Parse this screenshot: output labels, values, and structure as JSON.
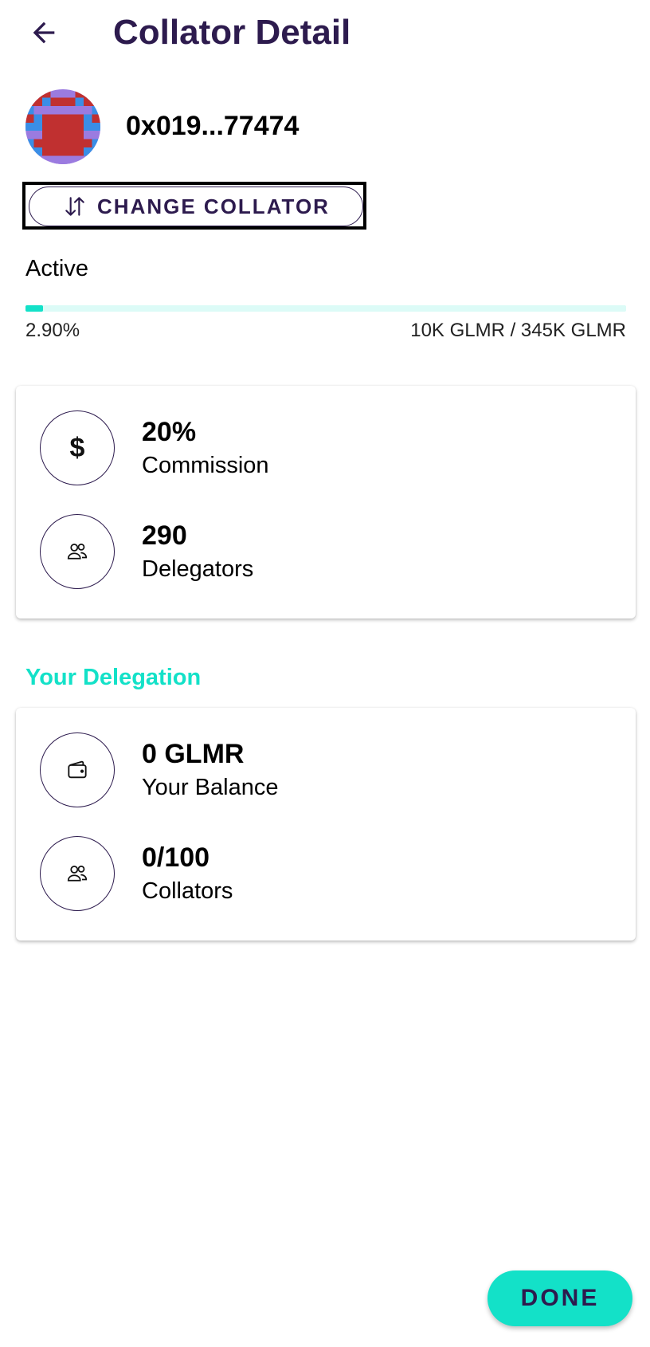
{
  "header": {
    "title": "Collator Detail",
    "back_icon": "arrow-left-icon"
  },
  "collator": {
    "address": "0x019...77474",
    "avatar_colors": [
      "#9b7be0",
      "#c03030",
      "#3a8ee6"
    ]
  },
  "change_button": {
    "label": "CHANGE COLLATOR",
    "icon": "swap-vertical-icon"
  },
  "status": {
    "label": "Active",
    "progress_percent": 2.9,
    "percent_text": "2.90%",
    "stake_text": "10K GLMR / 345K GLMR"
  },
  "stats": [
    {
      "value": "20%",
      "label": "Commission",
      "icon": "dollar-icon",
      "glyph": "$"
    },
    {
      "value": "290",
      "label": "Delegators",
      "icon": "people-icon"
    }
  ],
  "delegation": {
    "title": "Your Delegation",
    "items": [
      {
        "value": "0 GLMR",
        "label": "Your Balance",
        "icon": "wallet-icon"
      },
      {
        "value": "0/100",
        "label": "Collators",
        "icon": "people-icon"
      }
    ]
  },
  "done_button": {
    "label": "DONE"
  },
  "colors": {
    "primary": "#2d1b4e",
    "accent": "#13e1c8",
    "track": "#dcfbf7"
  }
}
